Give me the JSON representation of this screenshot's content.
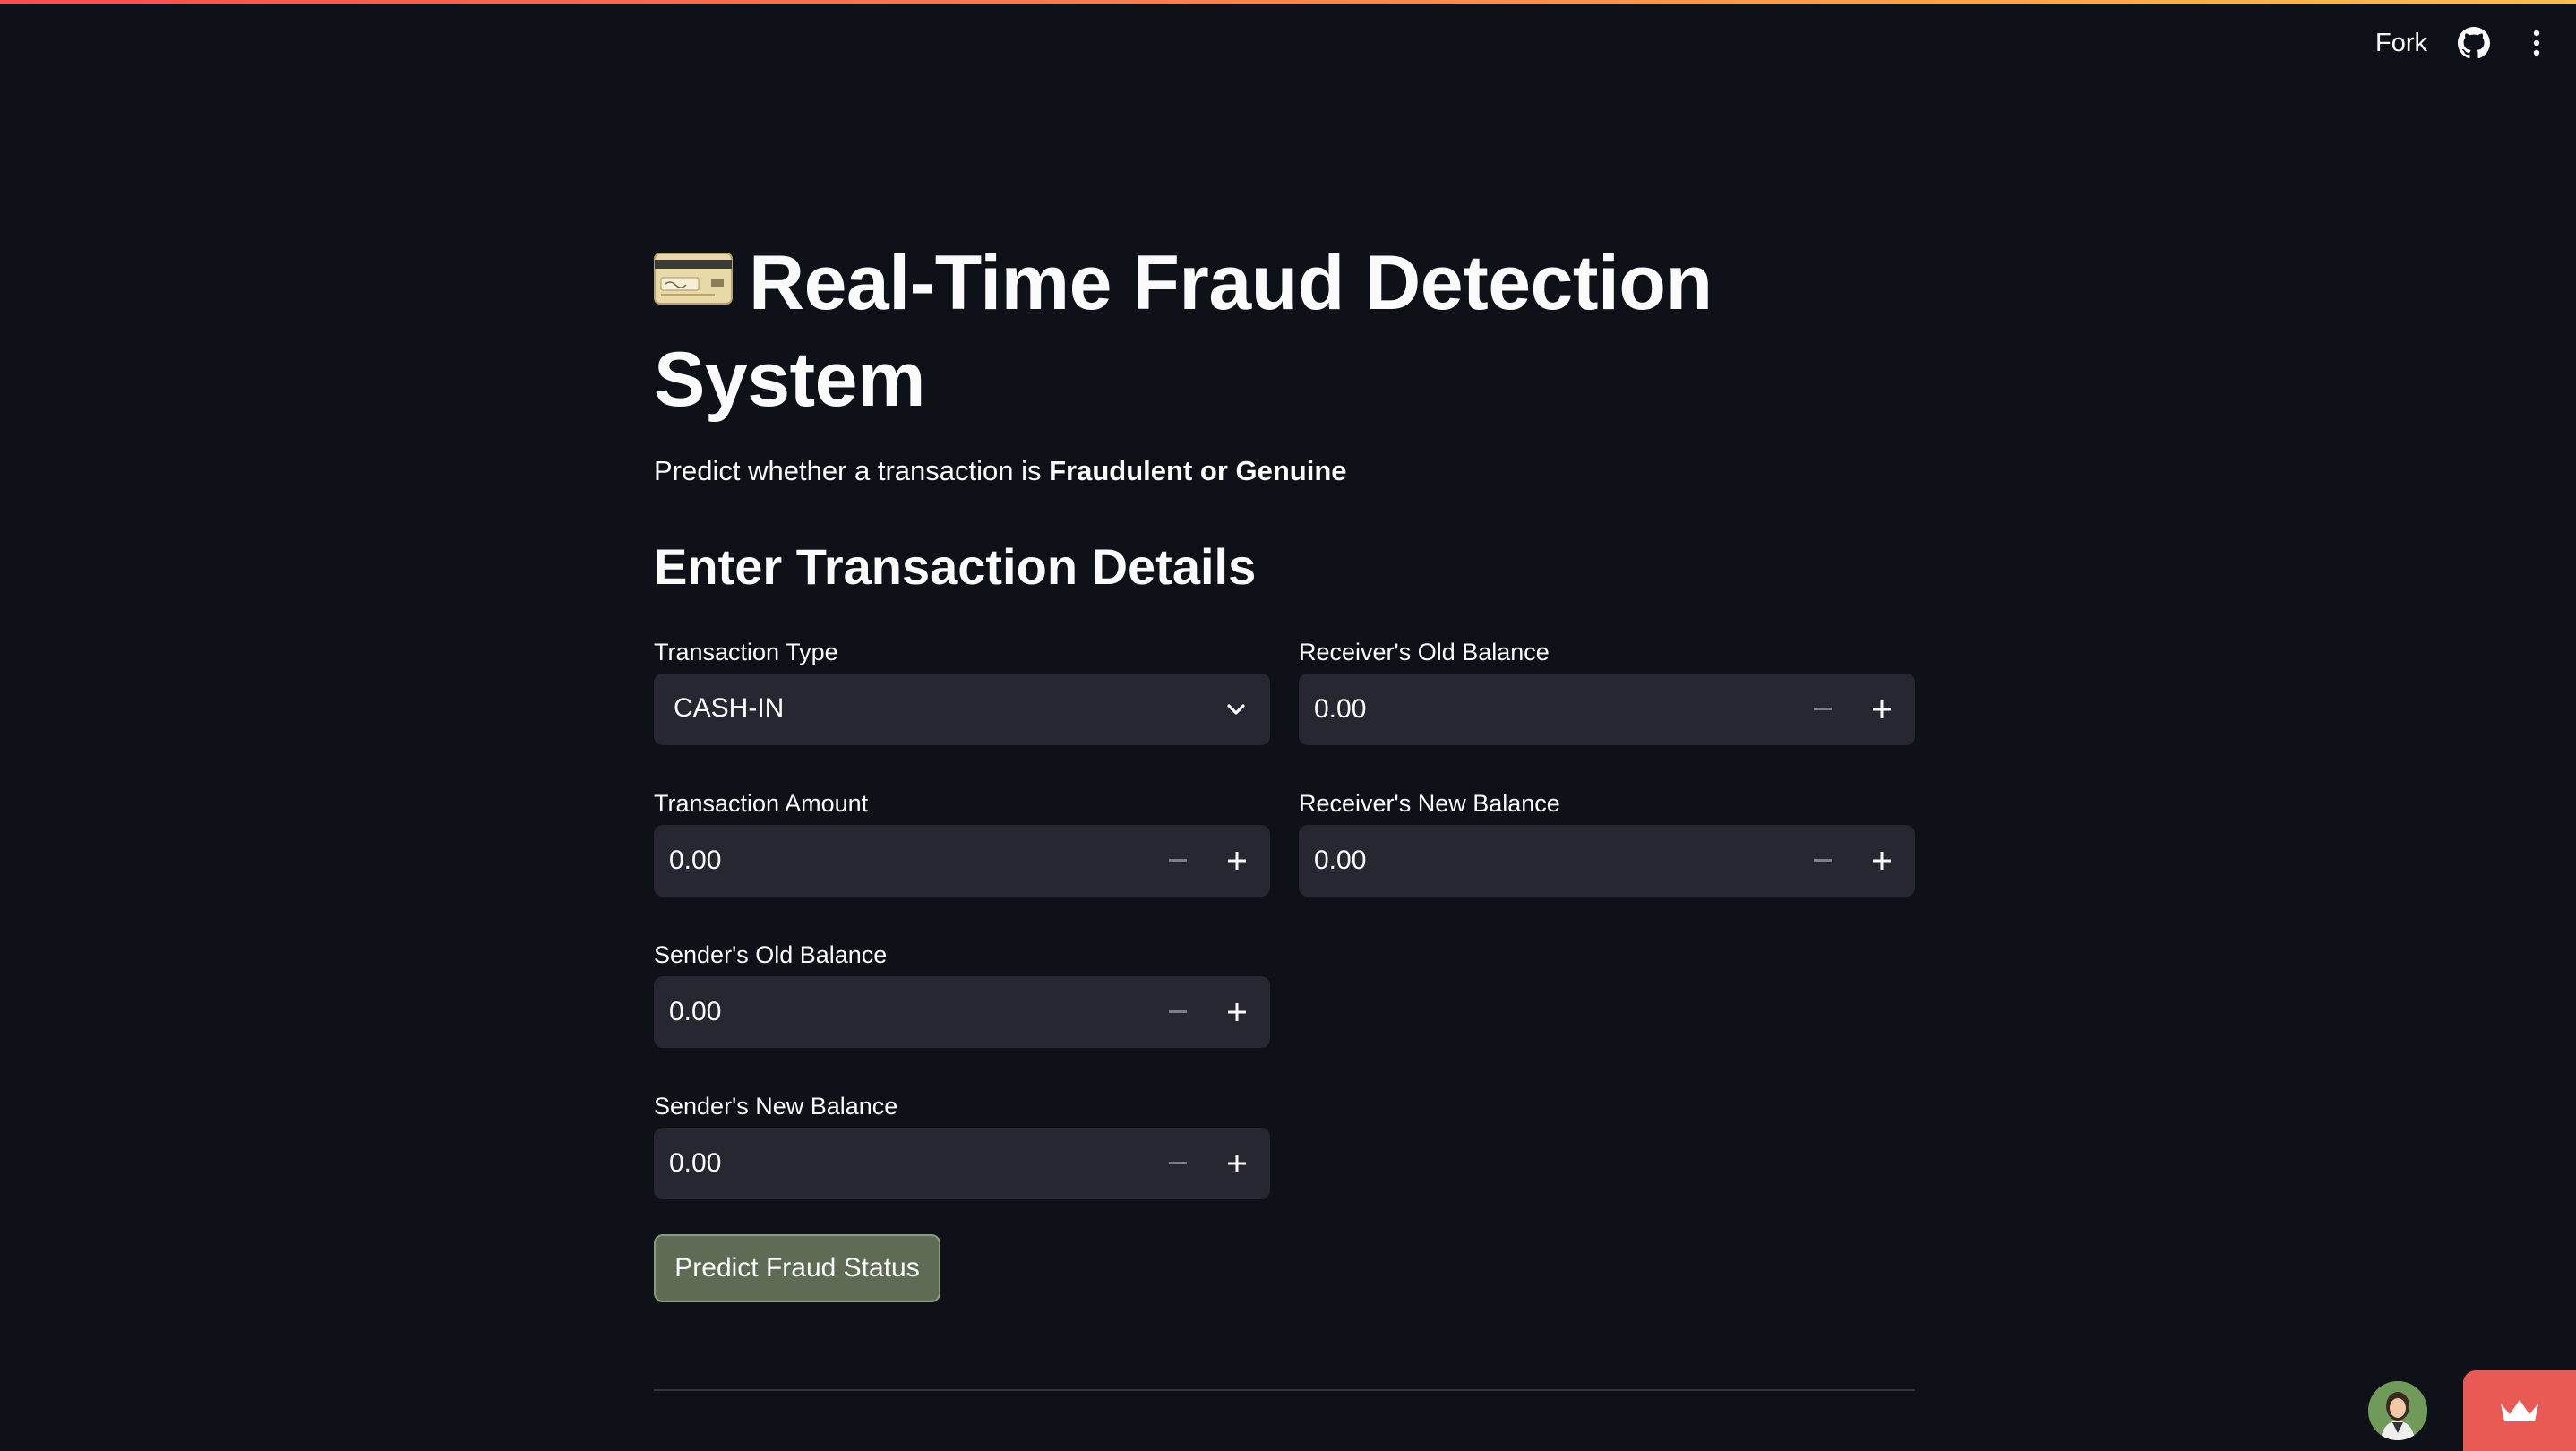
{
  "header": {
    "fork_label": "Fork",
    "github_icon": "github-icon",
    "menu_icon": "more-vertical-icon"
  },
  "page": {
    "title_icon": "credit-card-icon",
    "title": "Real-Time Fraud Detection System",
    "subtitle_prefix": "Predict whether a transaction is ",
    "subtitle_bold": "Fraudulent or Genuine",
    "section_heading": "Enter Transaction Details"
  },
  "form": {
    "transaction_type": {
      "label": "Transaction Type",
      "value": "CASH-IN"
    },
    "transaction_amount": {
      "label": "Transaction Amount",
      "value": "0.00"
    },
    "sender_old_balance": {
      "label": "Sender's Old Balance",
      "value": "0.00"
    },
    "sender_new_balance": {
      "label": "Sender's New Balance",
      "value": "0.00"
    },
    "receiver_old_balance": {
      "label": "Receiver's Old Balance",
      "value": "0.00"
    },
    "receiver_new_balance": {
      "label": "Receiver's New Balance",
      "value": "0.00"
    },
    "predict_button": "Predict Fraud Status"
  },
  "colors": {
    "background": "#0e1117",
    "input_bg": "#262730",
    "button_bg": "#5f6b54",
    "badge": "#ea5a55"
  }
}
